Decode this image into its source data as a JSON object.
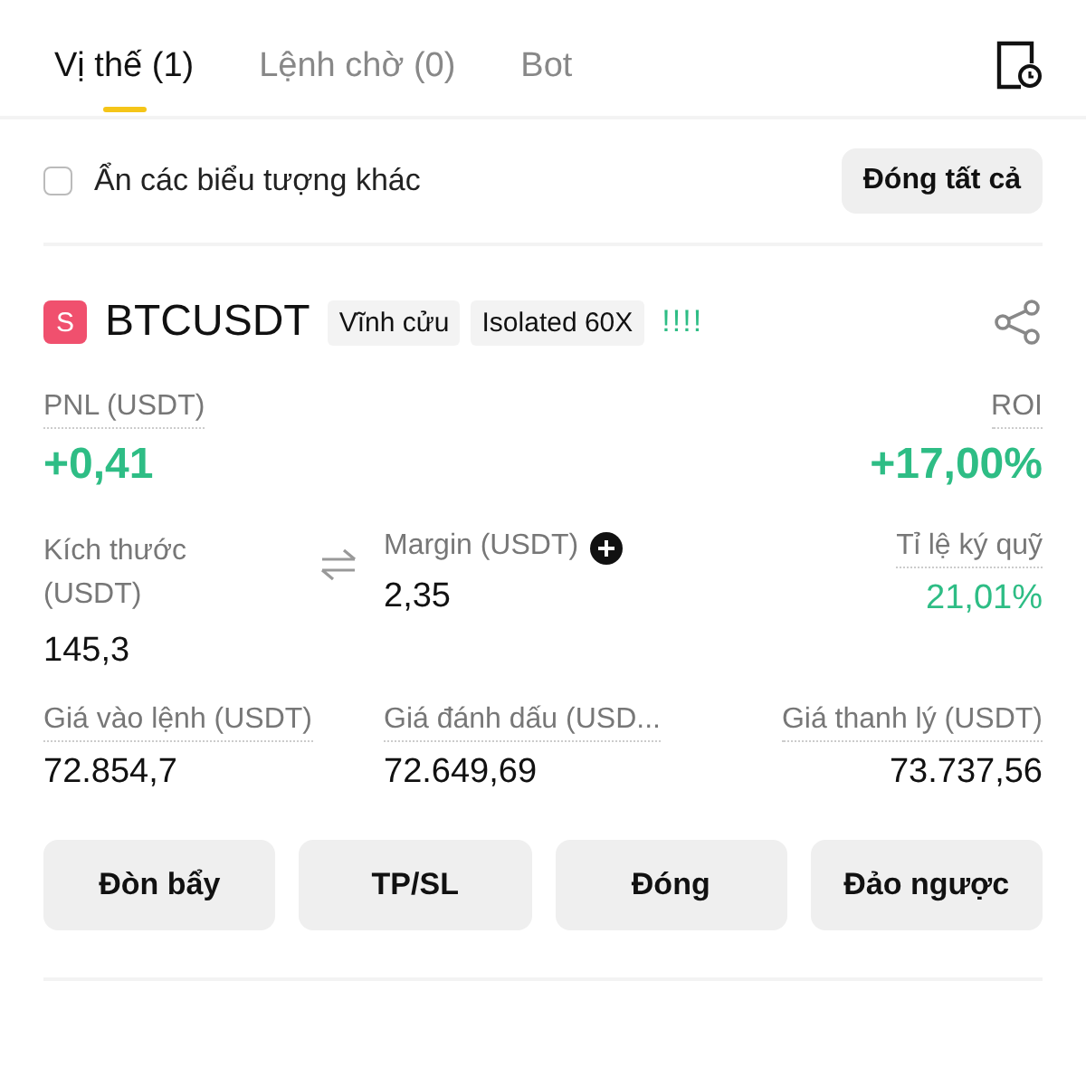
{
  "tabs": [
    {
      "label": "Vị thế (1)",
      "selected": true
    },
    {
      "label": "Lệnh chờ (0)",
      "selected": false
    },
    {
      "label": "Bot",
      "selected": false
    }
  ],
  "filter": {
    "label": "Ẩn các biểu tượng khác",
    "checked": false,
    "button": "Đóng tất cả"
  },
  "position": {
    "side_badge": "S",
    "symbol": "BTCUSDT",
    "tags": [
      "Vĩnh cửu",
      "Isolated 60X"
    ],
    "risk": "!!!!",
    "pnl": {
      "label": "PNL (USDT)",
      "value": "+0,41"
    },
    "roi": {
      "label": "ROI",
      "value": "+17,00%"
    },
    "stats": [
      {
        "label": "Kích thước (USDT)",
        "value": "145,3",
        "kind": "swap",
        "dotted": false,
        "gain": false
      },
      {
        "label": "Margin (USDT)",
        "value": "2,35",
        "kind": "add",
        "dotted": false,
        "gain": false
      },
      {
        "label": "Tỉ lệ ký quỹ",
        "value": "21,01%",
        "kind": "plain",
        "dotted": true,
        "gain": true
      },
      {
        "label": "Giá vào lệnh (USDT)",
        "value": "72.854,7",
        "kind": "plain",
        "dotted": true,
        "gain": false
      },
      {
        "label": "Giá đánh dấu (USD...",
        "value": "72.649,69",
        "kind": "plain",
        "dotted": true,
        "gain": false
      },
      {
        "label": "Giá thanh lý (USDT)",
        "value": "73.737,56",
        "kind": "plain",
        "dotted": true,
        "gain": false
      }
    ],
    "actions": [
      "Đòn bẩy",
      "TP/SL",
      "Đóng",
      "Đảo ngược"
    ]
  }
}
